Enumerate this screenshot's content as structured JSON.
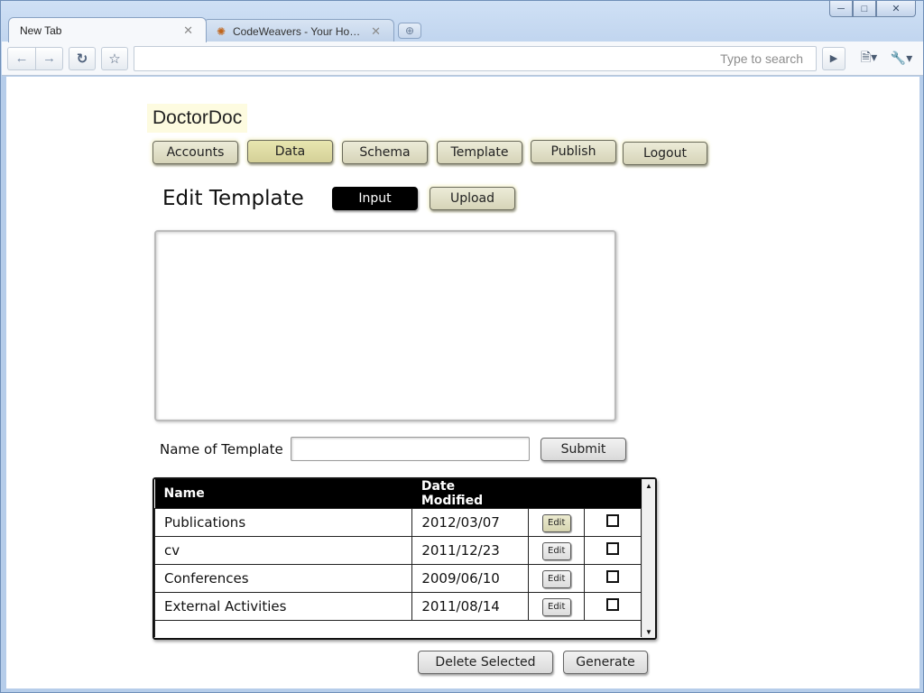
{
  "browser": {
    "tabs": [
      {
        "label": "New Tab",
        "active": true
      },
      {
        "label": "CodeWeavers - Your Home…",
        "active": false
      }
    ],
    "search_placeholder": "Type to search"
  },
  "app": {
    "title": "DoctorDoc",
    "nav": [
      "Accounts",
      "Data",
      "Schema",
      "Template",
      "Publish",
      "Logout"
    ],
    "selected_nav": "Data"
  },
  "editor": {
    "heading": "Edit Template",
    "mode_input": "Input",
    "mode_upload": "Upload",
    "name_label": "Name of Template",
    "name_value": "",
    "submit": "Submit"
  },
  "templates": {
    "columns": [
      "Name",
      "Date Modified"
    ],
    "rows": [
      {
        "name": "Publications",
        "date": "2012/03/07",
        "edit": "Edit"
      },
      {
        "name": "cv",
        "date": "2011/12/23",
        "edit": "Edit"
      },
      {
        "name": "Conferences",
        "date": "2009/06/10",
        "edit": "Edit"
      },
      {
        "name": "External Activities",
        "date": "2011/08/14",
        "edit": "Edit"
      }
    ]
  },
  "actions": {
    "delete_selected": "Delete Selected",
    "generate": "Generate"
  }
}
